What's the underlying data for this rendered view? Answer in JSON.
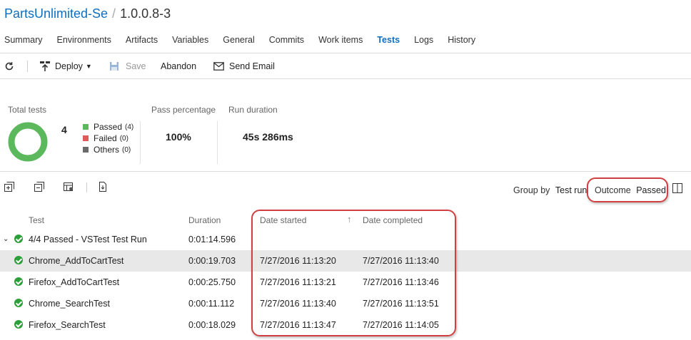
{
  "header": {
    "project": "PartsUnlimited-Se",
    "separator": "/",
    "release": "1.0.0.8-3"
  },
  "tabs": [
    {
      "label": "Summary"
    },
    {
      "label": "Environments"
    },
    {
      "label": "Artifacts"
    },
    {
      "label": "Variables"
    },
    {
      "label": "General"
    },
    {
      "label": "Commits"
    },
    {
      "label": "Work items"
    },
    {
      "label": "Tests",
      "active": true
    },
    {
      "label": "Logs"
    },
    {
      "label": "History"
    }
  ],
  "toolbar": {
    "deploy": "Deploy",
    "save": "Save",
    "abandon": "Abandon",
    "send_email": "Send Email"
  },
  "summary": {
    "total_label": "Total tests",
    "total_value": "4",
    "legend": [
      {
        "label": "Passed",
        "count": "(4)",
        "color": "#5cb85c"
      },
      {
        "label": "Failed",
        "count": "(0)",
        "color": "#e05a5a"
      },
      {
        "label": "Others",
        "count": "(0)",
        "color": "#6a6a6a"
      }
    ],
    "pass_label": "Pass percentage",
    "pass_value": "100%",
    "duration_label": "Run duration",
    "duration_value": "45s 286ms"
  },
  "grouping": {
    "group_by_label": "Group by",
    "group_by_value": "Test run",
    "outcome_label": "Outcome",
    "outcome_value": "Passed"
  },
  "table": {
    "columns": {
      "test": "Test",
      "duration": "Duration",
      "date_started": "Date started",
      "date_completed": "Date completed"
    },
    "group_row": {
      "name": "4/4 Passed - VSTest Test Run",
      "duration": "0:01:14.596"
    },
    "rows": [
      {
        "name": "Chrome_AddToCartTest",
        "duration": "0:00:19.703",
        "started": "7/27/2016 11:13:20",
        "completed": "7/27/2016 11:13:40"
      },
      {
        "name": "Firefox_AddToCartTest",
        "duration": "0:00:25.750",
        "started": "7/27/2016 11:13:21",
        "completed": "7/27/2016 11:13:46"
      },
      {
        "name": "Chrome_SearchTest",
        "duration": "0:00:11.112",
        "started": "7/27/2016 11:13:40",
        "completed": "7/27/2016 11:13:51"
      },
      {
        "name": "Firefox_SearchTest",
        "duration": "0:00:18.029",
        "started": "7/27/2016 11:13:47",
        "completed": "7/27/2016 11:14:05"
      }
    ]
  },
  "colors": {
    "accent": "#106ebe",
    "passed": "#2d9f3a",
    "callout": "#d04040"
  }
}
